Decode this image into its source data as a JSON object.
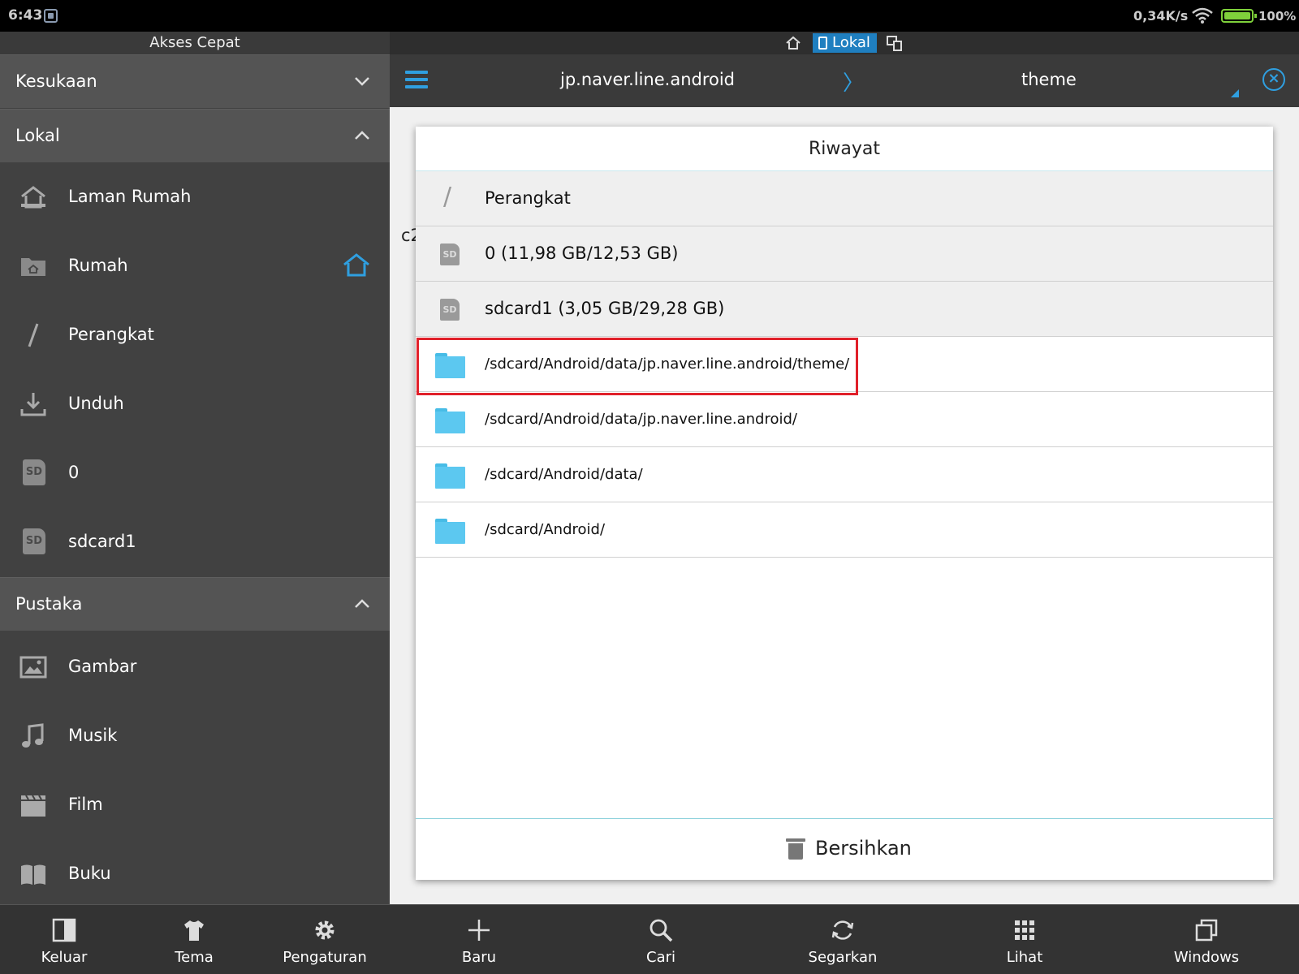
{
  "status": {
    "time": "6:43",
    "speed": "0,34K/s",
    "battery": "100%"
  },
  "sidebar": {
    "title": "Akses Cepat",
    "sections": {
      "favorites": "Kesukaan",
      "local": "Lokal",
      "library": "Pustaka"
    },
    "local_items": [
      {
        "label": "Laman Rumah",
        "icon": "home-page-icon"
      },
      {
        "label": "Rumah",
        "icon": "home-folder-icon"
      },
      {
        "label": "Perangkat",
        "icon": "slash-icon"
      },
      {
        "label": "Unduh",
        "icon": "download-icon"
      },
      {
        "label": "0",
        "icon": "sd-card-icon"
      },
      {
        "label": "sdcard1",
        "icon": "sd-card-icon"
      }
    ],
    "library_items": [
      {
        "label": "Gambar",
        "icon": "image-icon"
      },
      {
        "label": "Musik",
        "icon": "music-icon"
      },
      {
        "label": "Film",
        "icon": "film-icon"
      },
      {
        "label": "Buku",
        "icon": "book-icon"
      }
    ],
    "sd_badge": "SD"
  },
  "tabbar": {
    "active_tab": "Lokal"
  },
  "pathbar": {
    "segment1": "jp.naver.line.android",
    "separator": "〉",
    "segment2": "theme",
    "close_glyph": "×"
  },
  "content": {
    "peek_text": "c2"
  },
  "dialog": {
    "title": "Riwayat",
    "rows": [
      {
        "label": "Perangkat",
        "kind": "device"
      },
      {
        "label": "0 (11,98 GB/12,53 GB)",
        "kind": "sd"
      },
      {
        "label": "sdcard1 (3,05 GB/29,28 GB)",
        "kind": "sd"
      },
      {
        "label": "/sdcard/Android/data/jp.naver.line.android/theme/",
        "kind": "folder",
        "highlighted": true
      },
      {
        "label": "/sdcard/Android/data/jp.naver.line.android/",
        "kind": "folder"
      },
      {
        "label": "/sdcard/Android/data/",
        "kind": "folder"
      },
      {
        "label": "/sdcard/Android/",
        "kind": "folder"
      }
    ],
    "clear_label": "Bersihkan",
    "row_slash": "/"
  },
  "bottombar_left": [
    {
      "label": "Keluar",
      "icon": "exit-icon"
    },
    {
      "label": "Tema",
      "icon": "theme-shirt-icon"
    },
    {
      "label": "Pengaturan",
      "icon": "gear-icon"
    }
  ],
  "bottombar_right": [
    {
      "label": "Baru",
      "icon": "plus-icon"
    },
    {
      "label": "Cari",
      "icon": "search-icon"
    },
    {
      "label": "Segarkan",
      "icon": "refresh-icon"
    },
    {
      "label": "Lihat",
      "icon": "grid-view-icon"
    },
    {
      "label": "Windows",
      "icon": "windows-icon"
    }
  ],
  "colors": {
    "accent": "#2f9fe0",
    "folder": "#5cc8f0",
    "highlight": "#e0202a",
    "battery": "#7fd13b"
  }
}
